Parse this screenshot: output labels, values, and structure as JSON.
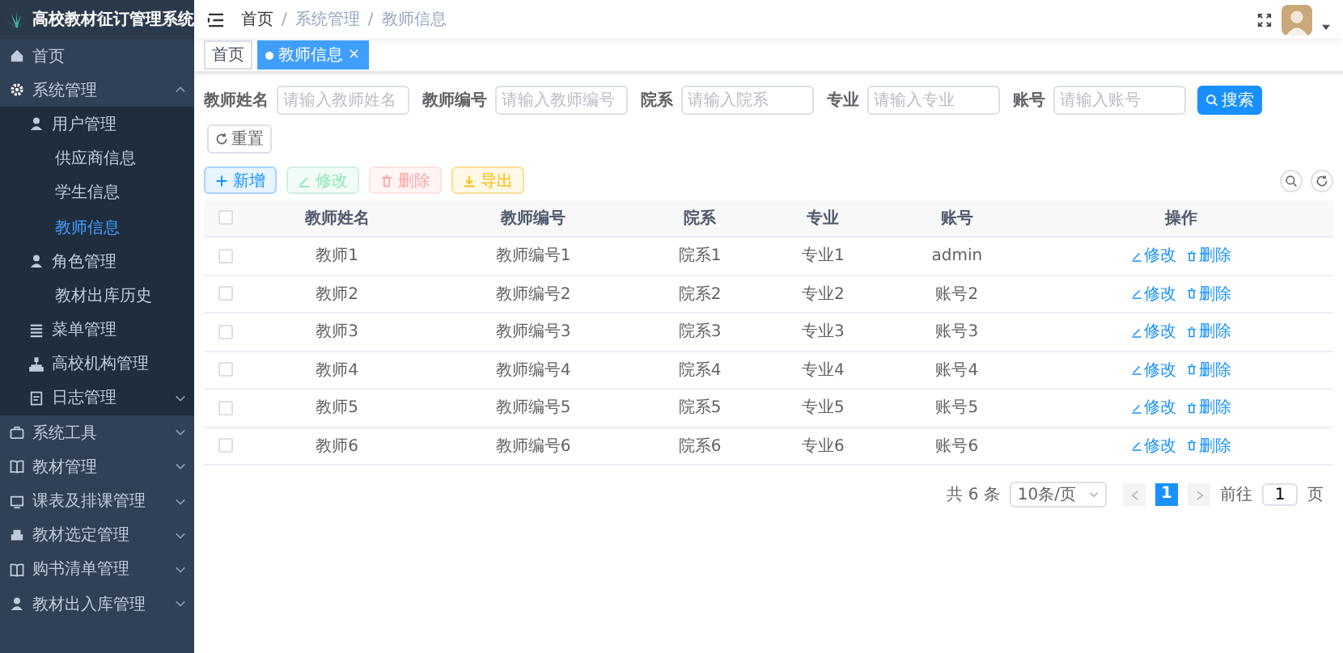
{
  "sidebar": {
    "logo_title": "高校教材征订管理系统",
    "items": [
      {
        "label": "首页",
        "selected": false
      },
      {
        "label": "系统管理",
        "selected": false,
        "expanded": true,
        "children": [
          {
            "label": "用户管理",
            "selected": false,
            "children": [
              {
                "label": "供应商信息",
                "selected": false
              },
              {
                "label": "学生信息",
                "selected": false
              },
              {
                "label": "教师信息",
                "selected": true
              }
            ]
          },
          {
            "label": "角色管理",
            "selected": false,
            "children": [
              {
                "label": "教材出库历史",
                "selected": false
              }
            ]
          },
          {
            "label": "菜单管理",
            "selected": false
          },
          {
            "label": "高校机构管理",
            "selected": false
          },
          {
            "label": "日志管理",
            "selected": false,
            "expanded": false
          }
        ]
      },
      {
        "label": "系统工具",
        "selected": false,
        "expanded": false
      },
      {
        "label": "教材管理",
        "selected": false,
        "expanded": false
      },
      {
        "label": "课表及排课管理",
        "selected": false,
        "expanded": false
      },
      {
        "label": "教材选定管理",
        "selected": false,
        "expanded": false
      },
      {
        "label": "购书清单管理",
        "selected": false,
        "expanded": false
      },
      {
        "label": "教材出入库管理",
        "selected": false,
        "expanded": false
      }
    ]
  },
  "breadcrumb": {
    "separator": "/",
    "items": [
      "首页",
      "系统管理",
      "教师信息"
    ]
  },
  "tags": [
    {
      "label": "首页",
      "selected": false
    },
    {
      "label": "教师信息",
      "selected": true,
      "close": "×"
    }
  ],
  "search": {
    "fields": [
      {
        "label": "教师姓名",
        "placeholder": "请输入教师姓名"
      },
      {
        "label": "教师编号",
        "placeholder": "请输入教师编号"
      },
      {
        "label": "院系",
        "placeholder": "请输入院系"
      },
      {
        "label": "专业",
        "placeholder": "请输入专业"
      },
      {
        "label": "账号",
        "placeholder": "请输入账号"
      }
    ],
    "buttons": [
      {
        "label": "搜索",
        "kind": "primary"
      },
      {
        "label": "重置",
        "kind": "default"
      }
    ]
  },
  "toolbar": [
    {
      "label": "新增",
      "kind": "add",
      "disabled": false
    },
    {
      "label": "修改",
      "kind": "edit",
      "disabled": true
    },
    {
      "label": "删除",
      "kind": "delete",
      "disabled": true
    },
    {
      "label": "导出",
      "kind": "export",
      "disabled": false
    }
  ],
  "table": {
    "select_all_checked": false,
    "columns": [
      "教师姓名",
      "教师编号",
      "院系",
      "专业",
      "账号",
      "操作"
    ],
    "rows": [
      {
        "checked": false,
        "cells": [
          "教师1",
          "教师编号1",
          "院系1",
          "专业1",
          "admin"
        ],
        "actions": [
          "修改",
          "删除"
        ]
      },
      {
        "checked": false,
        "cells": [
          "教师2",
          "教师编号2",
          "院系2",
          "专业2",
          "账号2"
        ],
        "actions": [
          "修改",
          "删除"
        ]
      },
      {
        "checked": false,
        "cells": [
          "教师3",
          "教师编号3",
          "院系3",
          "专业3",
          "账号3"
        ],
        "actions": [
          "修改",
          "删除"
        ]
      },
      {
        "checked": false,
        "cells": [
          "教师4",
          "教师编号4",
          "院系4",
          "专业4",
          "账号4"
        ],
        "actions": [
          "修改",
          "删除"
        ]
      },
      {
        "checked": false,
        "cells": [
          "教师5",
          "教师编号5",
          "院系5",
          "专业5",
          "账号5"
        ],
        "actions": [
          "修改",
          "删除"
        ]
      },
      {
        "checked": false,
        "cells": [
          "教师6",
          "教师编号6",
          "院系6",
          "专业6",
          "账号6"
        ],
        "actions": [
          "修改",
          "删除"
        ]
      }
    ]
  },
  "pagination": {
    "total": "共 6 条",
    "page_size": "10条/页",
    "pages": [
      {
        "label": "1",
        "selected": true
      }
    ],
    "goto_label": "前往",
    "goto_value": "1",
    "goto_suffix": "页"
  }
}
